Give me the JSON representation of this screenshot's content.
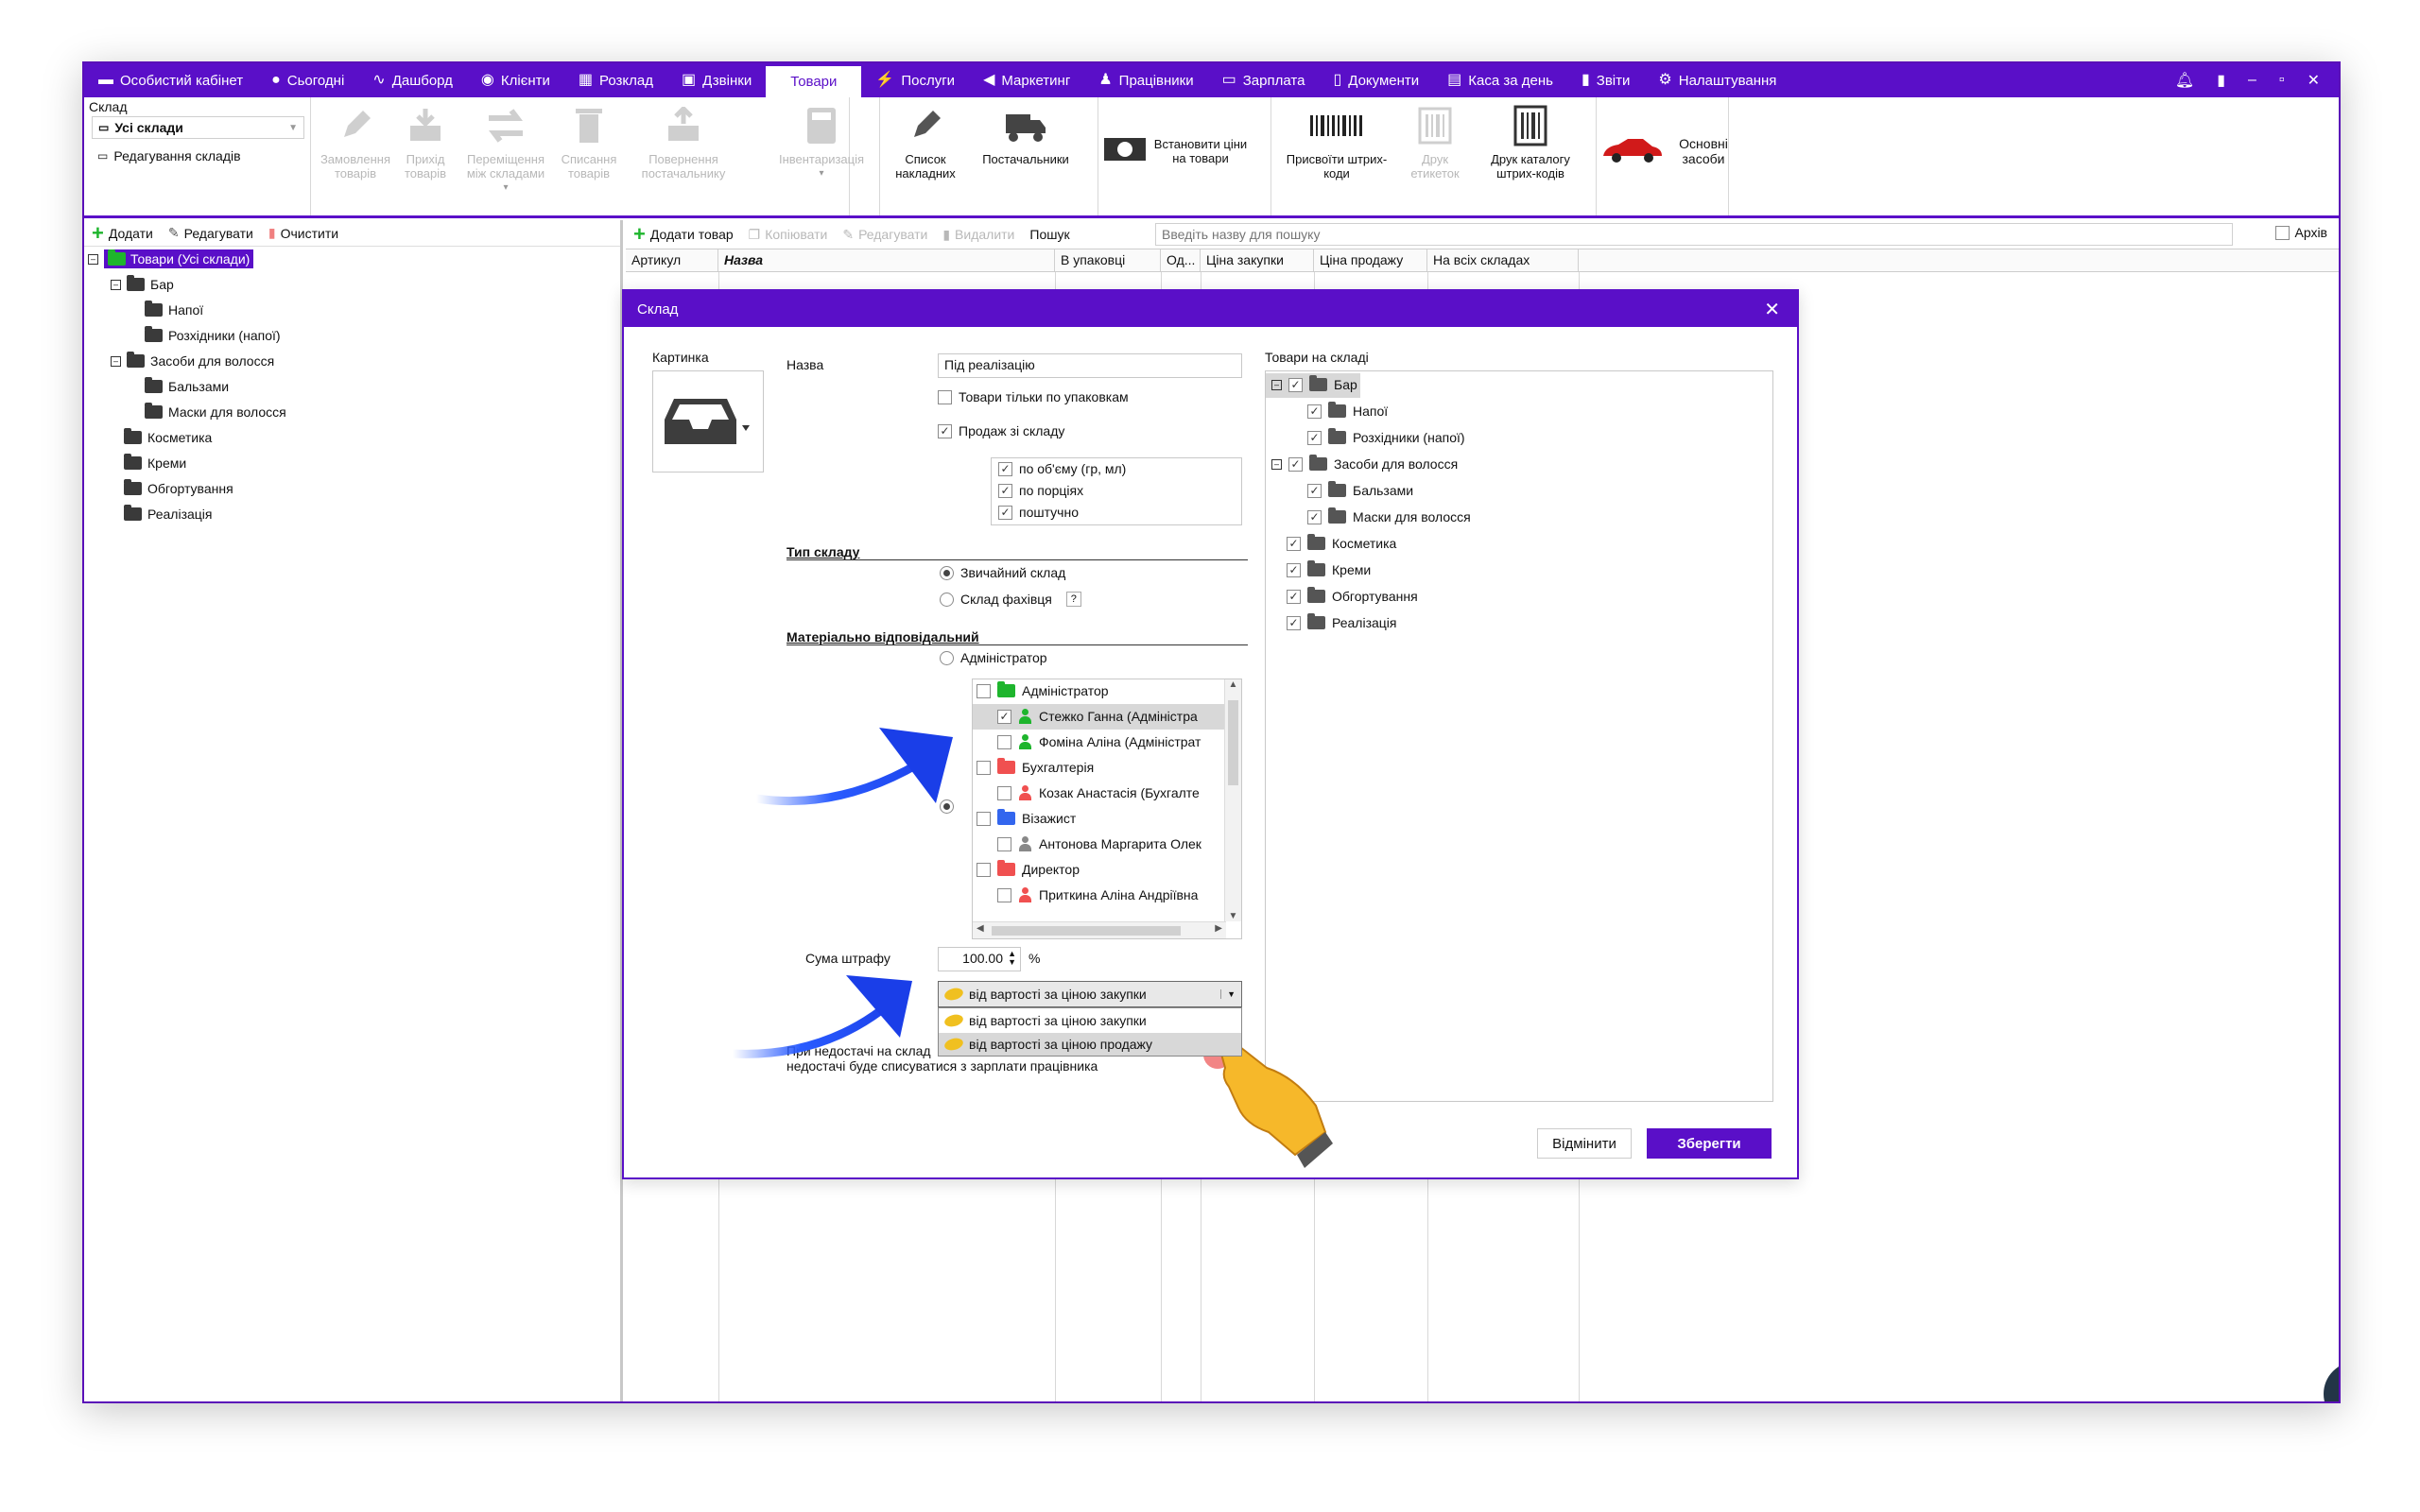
{
  "topnav": {
    "tabs": [
      {
        "label": "Особистий кабінет",
        "icon": "cabinet-icon"
      },
      {
        "label": "Сьогодні",
        "icon": "clock-icon"
      },
      {
        "label": "Дашборд",
        "icon": "pulse-icon"
      },
      {
        "label": "Клієнти",
        "icon": "user-circle-icon"
      },
      {
        "label": "Розклад",
        "icon": "calendar-icon"
      },
      {
        "label": "Дзвінки",
        "icon": "phone-icon"
      },
      {
        "label": "Товари",
        "icon": "",
        "active": true
      },
      {
        "label": "Послуги",
        "icon": "bolt-icon"
      },
      {
        "label": "Маркетинг",
        "icon": "megaphone-icon"
      },
      {
        "label": "Працівники",
        "icon": "person-icon"
      },
      {
        "label": "Зарплата",
        "icon": "money-icon"
      },
      {
        "label": "Документи",
        "icon": "document-icon"
      },
      {
        "label": "Каса за день",
        "icon": "calculator-icon"
      },
      {
        "label": "Звіти",
        "icon": "bar-chart-icon"
      },
      {
        "label": "Налаштування",
        "icon": "gear-icon"
      }
    ],
    "accent": "#5a0fc8"
  },
  "ribbon": {
    "warehouse_label": "Склад",
    "warehouse_value": "Усі склади",
    "edit_warehouses": "Редагування складів",
    "order_goods": "Замовлення товарів",
    "receipt_goods": "Прихід товарів",
    "move_goods": "Переміщення між складами",
    "writeoff_goods": "Списання товарів",
    "return_supplier": "Повернення постачальнику",
    "inventory": "Інвентаризація",
    "invoice_list": "Список накладних",
    "suppliers": "Постачальники",
    "set_prices": "Встановити ціни на товари",
    "assign_barcodes": "Присвоїти штрих-коди",
    "print_labels": "Друк етикеток",
    "print_barcode_catalog": "Друк каталогу штрих-кодів",
    "fixed_assets": "Основні засоби"
  },
  "left_panel": {
    "toolbar": {
      "add": "Додати",
      "edit": "Редагувати",
      "clear": "Очистити"
    },
    "tree": {
      "root": "Товари (Усі склади)",
      "bar": "Бар",
      "drinks": "Напої",
      "bottled_drinks": "Розхідники (напої)",
      "hair_care": "Засоби для волосся",
      "balms": "Бальзами",
      "hair_masks": "Маски для волосся",
      "cosmetics": "Косметика",
      "creams": "Креми",
      "equipment": "Обгортування",
      "sales": "Реалізація"
    }
  },
  "main_panel": {
    "toolbar": {
      "add_product": "Додати товар",
      "copy": "Копіювати",
      "edit": "Редагувати",
      "delete": "Видалити",
      "search_label": "Пошук",
      "search_placeholder": "Введіть назву для пошуку",
      "archive": "Архів"
    },
    "columns": [
      "Артикул",
      "Назва",
      "В упаковці",
      "Од...",
      "Ціна закупки",
      "Ціна продажу",
      "На всіх складах"
    ]
  },
  "dialog": {
    "title": "Склад",
    "picture_label": "Картинка",
    "name_label": "Назва",
    "name_value": "Під реалізацію",
    "only_packages": "Товари тільки по упаковкам",
    "sell_from_warehouse": "Продаж зі складу",
    "by_volume": "по об'єму (гр, мл)",
    "by_portions": "по порціях",
    "by_piece": "поштучно",
    "warehouse_type_title": "Тип складу",
    "regular_warehouse": "Звичайний склад",
    "specialist_warehouse": "Склад фахівця",
    "help_mark": "?",
    "responsible_title": "Матеріально відповідальний",
    "responsible_admin": "Адміністратор",
    "responsible_list": [
      {
        "label": "Адміністратор",
        "type": "group",
        "color": "#1eb52d",
        "checked": false
      },
      {
        "label": "Стежко Ганна (Адміністра",
        "type": "person",
        "color": "#1eb52d",
        "checked": true
      },
      {
        "label": "Фоміна Аліна (Адміністрат",
        "type": "person",
        "color": "#1eb52d",
        "checked": false
      },
      {
        "label": "Бухгалтерія",
        "type": "group",
        "color": "#f05050",
        "checked": false
      },
      {
        "label": "Козак Анастасія (Бухгалте",
        "type": "person",
        "color": "#f05050",
        "checked": false
      },
      {
        "label": "Візажист",
        "type": "group",
        "color": "#3366ee",
        "checked": false
      },
      {
        "label": "Антонова Маргарита Олек",
        "type": "person",
        "color": "#888888",
        "checked": false
      },
      {
        "label": "Директор",
        "type": "group",
        "color": "#f05050",
        "checked": false
      },
      {
        "label": "Приткина Аліна Андріївна",
        "type": "person",
        "color": "#f05050",
        "checked": false
      }
    ],
    "penalty_label": "Сума штрафу",
    "penalty_value": "100.00",
    "penalty_unit": "%",
    "penalty_basis_selected": "від вартості за ціною закупки",
    "penalty_basis_options": [
      "від вартості за ціною закупки",
      "від вартості за ціною продажу"
    ],
    "note_line1": "При недостачі на склад",
    "note_line2": "недостачі буде списуватися з зарплати працівника",
    "goods_in_warehouse": "Товари на складі",
    "goods_tree": {
      "bar": "Бар",
      "drinks": "Напої",
      "bottled_drinks": "Розхідники (напої)",
      "hair_care": "Засоби для волосся",
      "balms": "Бальзами",
      "hair_masks": "Маски для волосся",
      "cosmetics": "Косметика",
      "creams": "Креми",
      "equipment": "Обгортування",
      "sales": "Реалізація"
    },
    "cancel": "Відмінити",
    "save": "Зберегти"
  }
}
